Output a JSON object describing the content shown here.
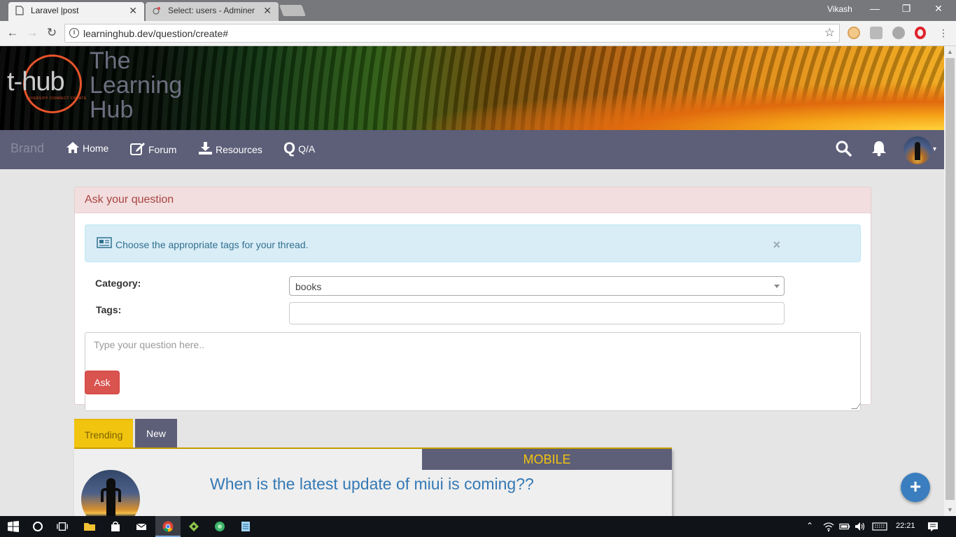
{
  "browser": {
    "tabs": [
      {
        "title": "Laravel |post",
        "close": "✕"
      },
      {
        "title": "Select: users - Adminer",
        "close": "✕"
      }
    ],
    "profile": "Vikash",
    "window_controls": {
      "minimize": "—",
      "restore": "❐",
      "close": "✕"
    },
    "url": "learninghub.dev/question/create#",
    "nav_icons": {
      "back": "←",
      "forward": "→",
      "reload": "↻",
      "star": "☆"
    }
  },
  "site": {
    "logo_text": "t-hub",
    "logo_tagline": "DIVERSIFY CONNECT CREATE",
    "title_lines": [
      "The",
      "Learning",
      "Hub"
    ]
  },
  "navbar": {
    "brand": "Brand",
    "items": [
      {
        "label": "Home",
        "icon": "home-icon"
      },
      {
        "label": "Forum",
        "icon": "edit-icon"
      },
      {
        "label": "Resources",
        "icon": "download-icon"
      },
      {
        "label": "Q/A",
        "icon": "q-icon",
        "glyph": "Q"
      }
    ],
    "right_icons": [
      "search-icon",
      "bell-icon",
      "avatar"
    ],
    "caret": "▾"
  },
  "question_form": {
    "heading": "Ask your question",
    "alert_text": "Choose the appropriate tags for your thread.",
    "alert_close": "×",
    "category_label": "Category:",
    "category_value": "books",
    "tags_label": "Tags:",
    "tags_value": "",
    "question_placeholder": "Type your question here..",
    "ask_button": "Ask"
  },
  "feed": {
    "tabs": [
      {
        "label": "Trending",
        "active": true
      },
      {
        "label": "New",
        "active": false
      }
    ],
    "cards": [
      {
        "category": "MOBILE",
        "title": "When is the latest update of miui is coming??"
      }
    ]
  },
  "fab": {
    "label": "+"
  },
  "taskbar": {
    "time": "22:21",
    "apps": [
      "start-icon",
      "cortana-icon",
      "task-view-icon",
      "file-explorer-icon",
      "store-icon",
      "mail-icon",
      "chrome-icon",
      "git-icon",
      "app-icon",
      "notepad-icon"
    ]
  },
  "colors": {
    "navbar": "#5d5e78",
    "panel_heading_bg": "#f2dede",
    "alert_bg": "#d9edf7",
    "ask_button": "#d9534f",
    "trending_tab": "#f1c40f",
    "card_title": "#3479b5",
    "fab": "#3a7ebf"
  }
}
